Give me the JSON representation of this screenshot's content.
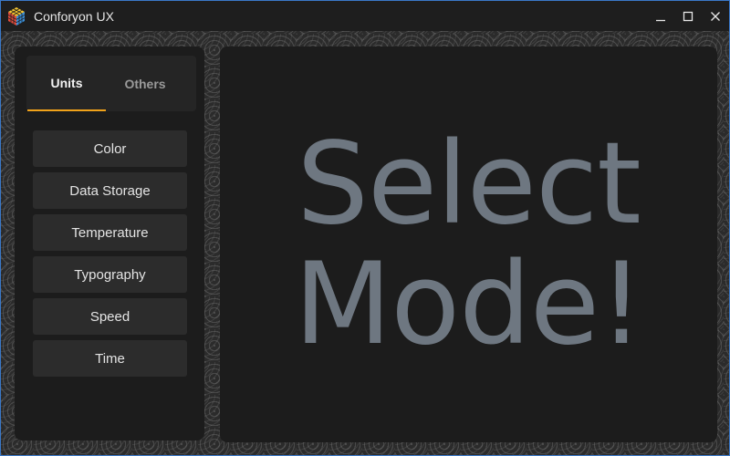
{
  "window": {
    "title": "Conforyon UX",
    "app_icon": "rubiks-cube-icon",
    "controls": [
      "minimize-icon",
      "maximize-icon",
      "close-icon"
    ]
  },
  "sidebar": {
    "tabs": [
      {
        "label": "Units",
        "active": true
      },
      {
        "label": "Others",
        "active": false
      }
    ],
    "modes": [
      {
        "label": "Color"
      },
      {
        "label": "Data Storage"
      },
      {
        "label": "Temperature"
      },
      {
        "label": "Typography"
      },
      {
        "label": "Speed"
      },
      {
        "label": "Time"
      }
    ]
  },
  "main": {
    "placeholder_lines": [
      "Select",
      "Mode!"
    ]
  },
  "colors": {
    "accent": "#f0a21a",
    "placeholder_text": "#6e7781",
    "panel_bg": "#1c1c1c",
    "window_border": "#3a78c8"
  }
}
